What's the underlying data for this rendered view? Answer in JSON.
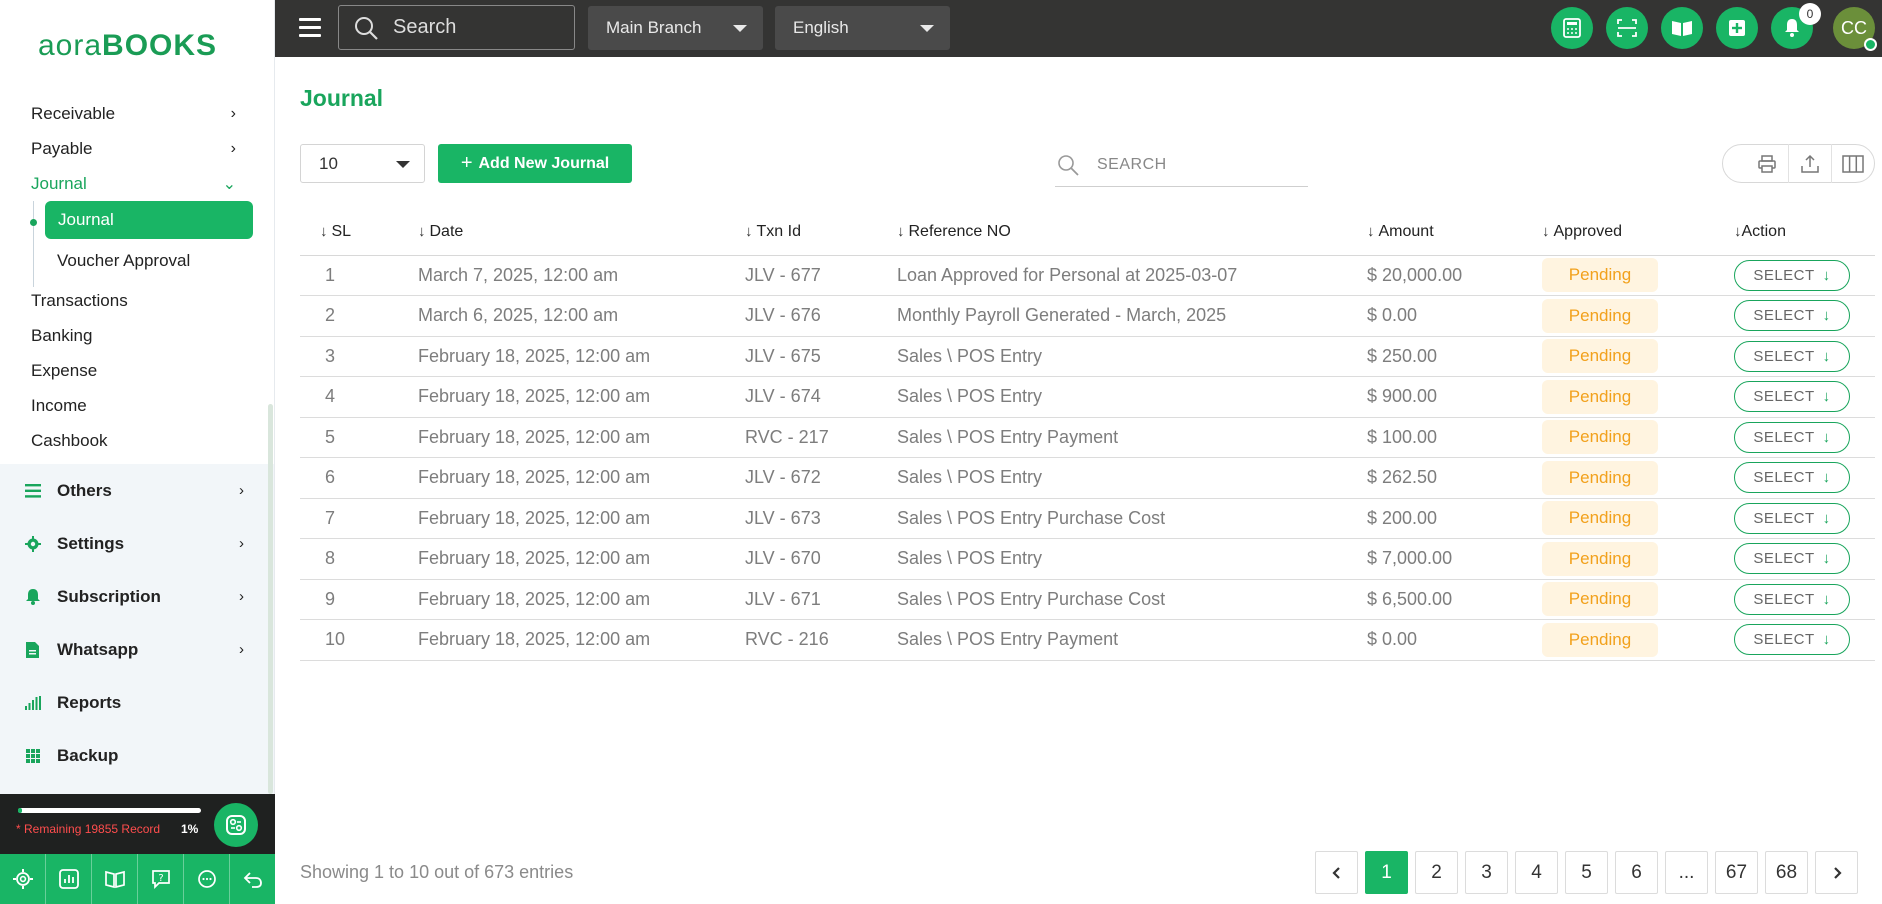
{
  "brand": {
    "logo_part1": "aora",
    "logo_part2": "BOOKS",
    "accent": "#19b565"
  },
  "topbar": {
    "search_placeholder": "Search",
    "branch": "Main Branch",
    "language": "English",
    "notification_count": "0",
    "avatar_initials": "CC"
  },
  "sidebar": {
    "sub_items": [
      {
        "label": "Receivable"
      },
      {
        "label": "Payable"
      },
      {
        "label": "Journal"
      }
    ],
    "journal_children": [
      {
        "label": "Journal"
      },
      {
        "label": "Voucher Approval"
      }
    ],
    "plain_items": [
      {
        "label": "Transactions"
      },
      {
        "label": "Banking"
      },
      {
        "label": "Expense"
      },
      {
        "label": "Income"
      },
      {
        "label": "Cashbook"
      }
    ],
    "groups": [
      {
        "label": "Others",
        "icon": "list-icon"
      },
      {
        "label": "Settings",
        "icon": "gear-icon"
      },
      {
        "label": "Subscription",
        "icon": "bell-icon"
      },
      {
        "label": "Whatsapp",
        "icon": "document-icon"
      },
      {
        "label": "Reports",
        "icon": "bar-chart-icon"
      },
      {
        "label": "Backup",
        "icon": "grid-icon"
      }
    ],
    "quota": {
      "text": "* Remaining 19855 Record",
      "percent_label": "1%",
      "fraction": 0.01
    }
  },
  "page": {
    "title": "Journal",
    "per_page": "10",
    "add_button": "Add New Journal",
    "search_placeholder": "SEARCH"
  },
  "table": {
    "columns": [
      "SL",
      "Date",
      "Txn Id",
      "Reference NO",
      "Amount",
      "Approved",
      "Action"
    ],
    "rows": [
      {
        "sl": "1",
        "date": "March 7, 2025, 12:00 am",
        "txn": "JLV - 677",
        "ref": "Loan Approved for Personal at 2025-03-07",
        "amount": "$ 20,000.00",
        "status": "Pending",
        "action": "SELECT"
      },
      {
        "sl": "2",
        "date": "March 6, 2025, 12:00 am",
        "txn": "JLV - 676",
        "ref": "Monthly Payroll Generated - March, 2025",
        "amount": "$ 0.00",
        "status": "Pending",
        "action": "SELECT"
      },
      {
        "sl": "3",
        "date": "February 18, 2025, 12:00 am",
        "txn": "JLV - 675",
        "ref": "Sales \\ POS Entry",
        "amount": "$ 250.00",
        "status": "Pending",
        "action": "SELECT"
      },
      {
        "sl": "4",
        "date": "February 18, 2025, 12:00 am",
        "txn": "JLV - 674",
        "ref": "Sales \\ POS Entry",
        "amount": "$ 900.00",
        "status": "Pending",
        "action": "SELECT"
      },
      {
        "sl": "5",
        "date": "February 18, 2025, 12:00 am",
        "txn": "RVC - 217",
        "ref": "Sales \\ POS Entry Payment",
        "amount": "$ 100.00",
        "status": "Pending",
        "action": "SELECT"
      },
      {
        "sl": "6",
        "date": "February 18, 2025, 12:00 am",
        "txn": "JLV - 672",
        "ref": "Sales \\ POS Entry",
        "amount": "$ 262.50",
        "status": "Pending",
        "action": "SELECT"
      },
      {
        "sl": "7",
        "date": "February 18, 2025, 12:00 am",
        "txn": "JLV - 673",
        "ref": "Sales \\ POS Entry Purchase Cost",
        "amount": "$ 200.00",
        "status": "Pending",
        "action": "SELECT"
      },
      {
        "sl": "8",
        "date": "February 18, 2025, 12:00 am",
        "txn": "JLV - 670",
        "ref": "Sales \\ POS Entry",
        "amount": "$ 7,000.00",
        "status": "Pending",
        "action": "SELECT"
      },
      {
        "sl": "9",
        "date": "February 18, 2025, 12:00 am",
        "txn": "JLV - 671",
        "ref": "Sales \\ POS Entry Purchase Cost",
        "amount": "$ 6,500.00",
        "status": "Pending",
        "action": "SELECT"
      },
      {
        "sl": "10",
        "date": "February 18, 2025, 12:00 am",
        "txn": "RVC - 216",
        "ref": "Sales \\ POS Entry Payment",
        "amount": "$ 0.00",
        "status": "Pending",
        "action": "SELECT"
      }
    ]
  },
  "footer": {
    "showing": "Showing 1 to 10 out of 673 entries",
    "pages": [
      "1",
      "2",
      "3",
      "4",
      "5",
      "6",
      "...",
      "67",
      "68"
    ],
    "current_page": "1"
  }
}
